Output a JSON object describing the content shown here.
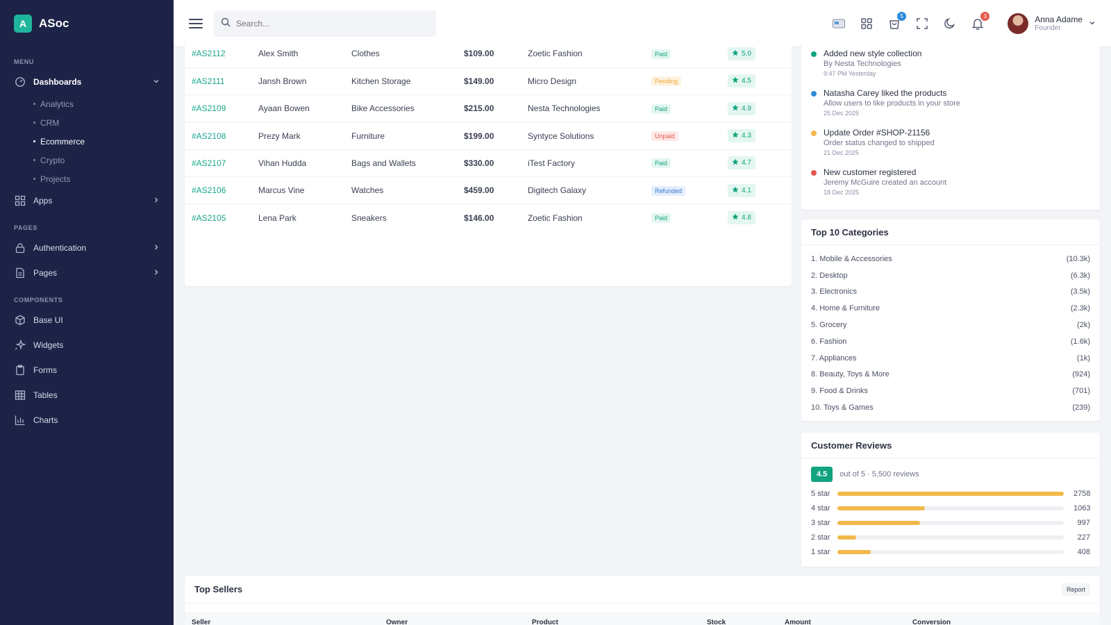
{
  "brand": {
    "logo_letter": "A",
    "name": "ASoc"
  },
  "sidebar": {
    "section_menu": "MENU",
    "dashboards": "Dashboards",
    "dash_sub": [
      "Analytics",
      "CRM",
      "Ecommerce",
      "Crypto",
      "Projects"
    ],
    "apps": "Apps",
    "section_pages": "PAGES",
    "authentication": "Authentication",
    "pages": "Pages",
    "section_components": "COMPONENTS",
    "base_ui": "Base UI",
    "widgets": "Widgets",
    "forms": "Forms",
    "tables": "Tables",
    "charts": "Charts"
  },
  "topbar": {
    "search_placeholder": "Search...",
    "cart_badge": "5",
    "notif_badge": "3",
    "user_name": "Anna Adame",
    "user_role": "Founder"
  },
  "orders": [
    {
      "id": "#AS2112",
      "customer": "Alex Smith",
      "product": "Clothes",
      "amount": "$109.00",
      "vendor": "Zoetic Fashion",
      "status": "Paid",
      "status_kind": "paid",
      "rating": "5.0"
    },
    {
      "id": "#AS2111",
      "customer": "Jansh Brown",
      "product": "Kitchen Storage",
      "amount": "$149.00",
      "vendor": "Micro Design",
      "status": "Pending",
      "status_kind": "pending",
      "rating": "4.5"
    },
    {
      "id": "#AS2109",
      "customer": "Ayaan Bowen",
      "product": "Bike Accessories",
      "amount": "$215.00",
      "vendor": "Nesta Technologies",
      "status": "Paid",
      "status_kind": "paid",
      "rating": "4.9"
    },
    {
      "id": "#AS2108",
      "customer": "Prezy Mark",
      "product": "Furniture",
      "amount": "$199.00",
      "vendor": "Syntyce Solutions",
      "status": "Unpaid",
      "status_kind": "unpaid",
      "rating": "4.3"
    },
    {
      "id": "#AS2107",
      "customer": "Vihan Hudda",
      "product": "Bags and Wallets",
      "amount": "$330.00",
      "vendor": "iTest Factory",
      "status": "Paid",
      "status_kind": "paid",
      "rating": "4.7"
    },
    {
      "id": "#AS2106",
      "customer": "Marcus Vine",
      "product": "Watches",
      "amount": "$459.00",
      "vendor": "Digitech Galaxy",
      "status": "Refunded",
      "status_kind": "refunded",
      "rating": "4.1"
    },
    {
      "id": "#AS2105",
      "customer": "Lena Park",
      "product": "Sneakers",
      "amount": "$146.00",
      "vendor": "Zoetic Fashion",
      "status": "Paid",
      "status_kind": "paid",
      "rating": "4.8"
    }
  ],
  "activity": [
    {
      "title": "Added new style collection",
      "desc": "By Nesta Technologies",
      "time": "9:47 PM Yesterday",
      "color": "#12a37f"
    },
    {
      "title": "Natasha Carey liked the products",
      "desc": "Allow users to like products in your store",
      "time": "25 Dec 2025",
      "color": "#2e8bd8"
    },
    {
      "title": "Update Order #SHOP-21156",
      "desc": "Order status changed to shipped",
      "time": "21 Dec 2025",
      "color": "#f1b94b"
    },
    {
      "title": "New customer registered",
      "desc": "Jeremy McGuire created an account",
      "time": "18 Dec 2025",
      "color": "#e4574a"
    }
  ],
  "categories": {
    "title": "Top 10 Categories",
    "items": [
      {
        "name": "1. Mobile & Accessories",
        "count": "(10.3k)"
      },
      {
        "name": "2. Desktop",
        "count": "(6.3k)"
      },
      {
        "name": "3. Electronics",
        "count": "(3.5k)"
      },
      {
        "name": "4. Home & Furniture",
        "count": "(2.3k)"
      },
      {
        "name": "5. Grocery",
        "count": "(2k)"
      },
      {
        "name": "6. Fashion",
        "count": "(1.6k)"
      },
      {
        "name": "7. Appliances",
        "count": "(1k)"
      },
      {
        "name": "8. Beauty, Toys & More",
        "count": "(924)"
      },
      {
        "name": "9. Food & Drinks",
        "count": "(701)"
      },
      {
        "name": "10. Toys & Games",
        "count": "(239)"
      }
    ]
  },
  "reviews": {
    "title": "Customer Reviews",
    "score": "4.5",
    "summary": "out of 5 · 5,500 reviews",
    "rows": [
      {
        "label": "5 star",
        "count": "2758",
        "fill": 1.0
      },
      {
        "label": "4 star",
        "count": "1063",
        "fill": 0.385
      },
      {
        "label": "3 star",
        "count": "997",
        "fill": 0.364
      },
      {
        "label": "2 star",
        "count": "227",
        "fill": 0.082
      },
      {
        "label": "1 star",
        "count": "408",
        "fill": 0.148
      }
    ]
  },
  "sellers": {
    "title": "Top Sellers",
    "report_label": "Report",
    "columns": [
      "Seller",
      "Owner",
      "Product",
      "Stock",
      "Amount",
      "Conversion"
    ]
  },
  "colors": {
    "sidebar_bg": "#1c2347",
    "accent": "#1fb59c",
    "star_bar": "#f1b94b"
  }
}
